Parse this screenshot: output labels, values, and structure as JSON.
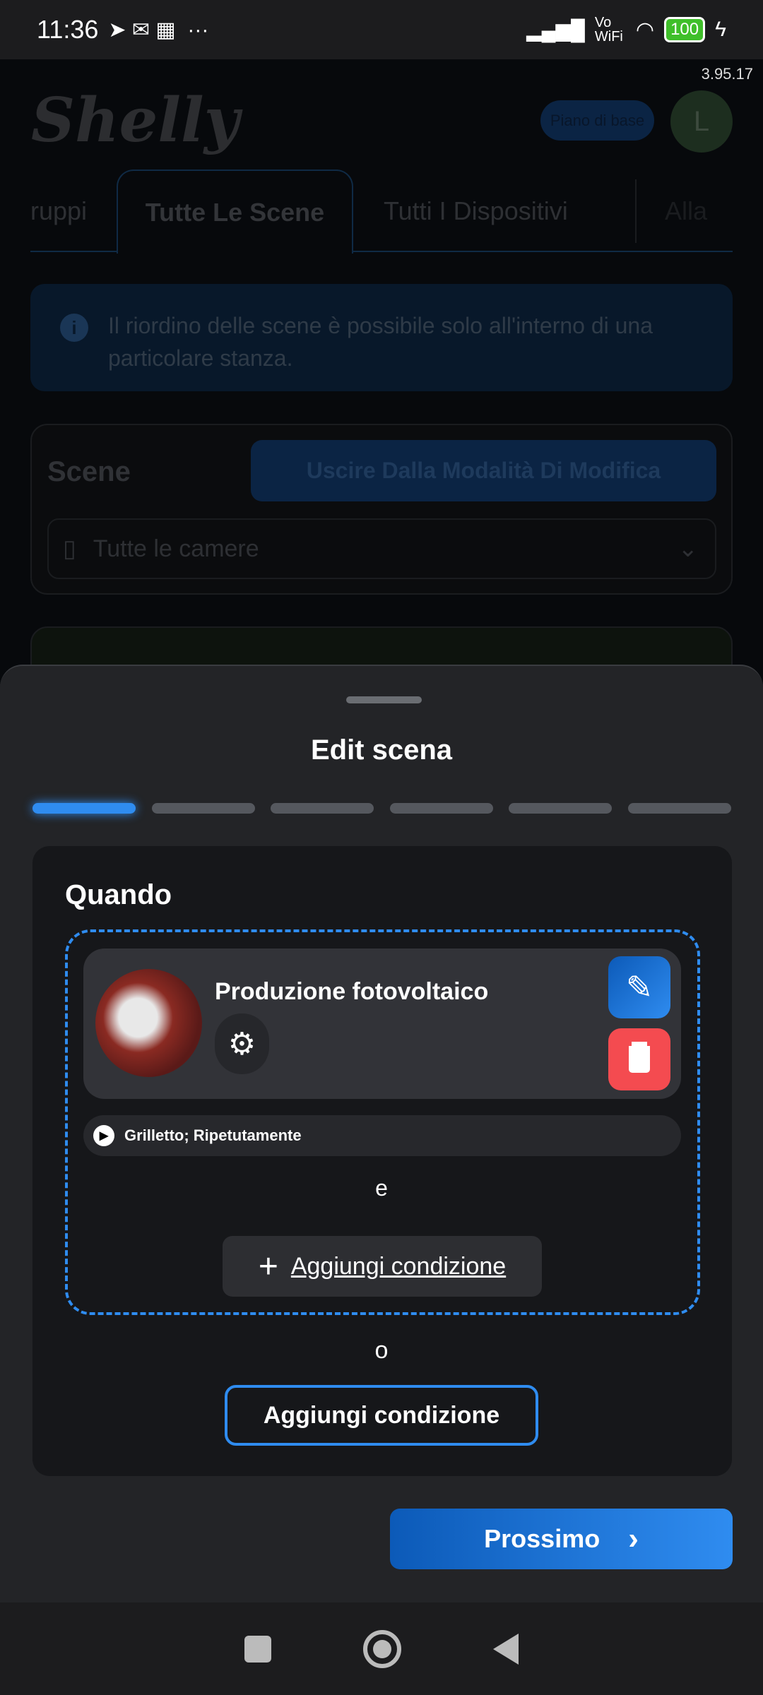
{
  "status_bar": {
    "time": "11:36",
    "network": "Vo WiFi",
    "battery": "100"
  },
  "app": {
    "version": "3.95.17",
    "logo": "Shelly",
    "plan_badge": "Piano di base",
    "avatar_initial": "L"
  },
  "tabs": [
    {
      "label": "ruppi"
    },
    {
      "label": "Tutte Le Scene",
      "active": true
    },
    {
      "label": "Tutti I Dispositivi"
    },
    {
      "label": "Alla"
    }
  ],
  "info_banner": {
    "text": "Il riordino delle scene è possibile solo all'interno di una particolare stanza."
  },
  "scenes_panel": {
    "title": "Scene",
    "exit_edit_button": "Uscire Dalla Modalità Di Modifica",
    "room_select": "Tutte le camere"
  },
  "sheet": {
    "title": "Edit scena",
    "steps_total": 6,
    "current_step": 1,
    "section_title": "Quando",
    "condition": {
      "device_name": "Produzione fotovoltaico",
      "trigger": "Grilletto; Ripetutamente"
    },
    "and_label": "e",
    "add_condition_inline": "Aggiungi condizione",
    "or_label": "o",
    "add_condition_button": "Aggiungi condizione",
    "next_button": "Prossimo"
  },
  "colors": {
    "accent": "#2f8cf0",
    "delete": "#f44b50",
    "sheet_bg": "#232427"
  }
}
